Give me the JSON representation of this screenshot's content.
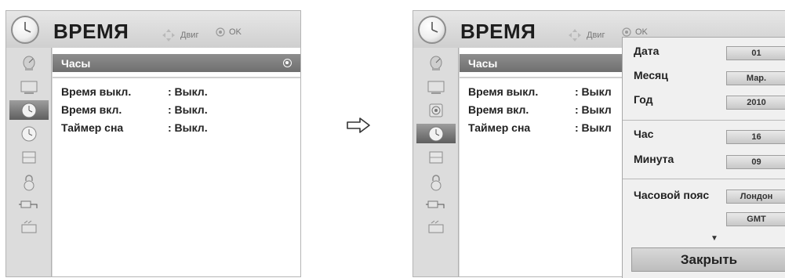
{
  "left_screen": {
    "title": "ВРЕМЯ",
    "hints": {
      "move": "Двиг",
      "ok": "OK"
    },
    "sidebar": [
      {
        "icon": "satellite-dish-icon"
      },
      {
        "icon": "monitor-icon"
      },
      {
        "icon": "clock-icon",
        "selected": true
      },
      {
        "icon": "clock-icon"
      },
      {
        "icon": "parental-lock-icon"
      },
      {
        "icon": "padlock-icon"
      },
      {
        "icon": "input-plug-icon"
      },
      {
        "icon": "keyboard-icon"
      }
    ],
    "menu": {
      "selected_item": "Часы",
      "items": [
        {
          "label": "Время выкл.",
          "value": ": Выкл."
        },
        {
          "label": "Время вкл.",
          "value": ": Выкл."
        },
        {
          "label": "Таймер сна",
          "value": ": Выкл."
        }
      ]
    }
  },
  "transition_arrow": "arrow-right-icon",
  "right_screen": {
    "title": "ВРЕМЯ",
    "hints": {
      "move": "Двиг",
      "ok": "OK"
    },
    "sidebar": [
      {
        "icon": "satellite-dish-icon"
      },
      {
        "icon": "monitor-icon"
      },
      {
        "icon": "speaker-icon"
      },
      {
        "icon": "clock-icon",
        "selected": true
      },
      {
        "icon": "parental-lock-icon"
      },
      {
        "icon": "padlock-icon"
      },
      {
        "icon": "input-plug-icon"
      },
      {
        "icon": "keyboard-icon"
      }
    ],
    "menu": {
      "selected_item": "Часы",
      "items": [
        {
          "label": "Время выкл.",
          "value": ": Выкл"
        },
        {
          "label": "Время вкл.",
          "value": ": Выкл"
        },
        {
          "label": "Таймер сна",
          "value": ": Выкл"
        }
      ]
    },
    "clock_popup": {
      "fields": [
        {
          "label": "Дата",
          "value": "01"
        },
        {
          "label": "Месяц",
          "value": "Мар."
        },
        {
          "label": "Год",
          "value": "2010"
        },
        {
          "label": "Час",
          "value": "16"
        },
        {
          "label": "Минута",
          "value": "09"
        },
        {
          "label": "Часовой пояс",
          "value": "Лондон"
        },
        {
          "label": "",
          "value": "GMT"
        }
      ],
      "more_indicator": "▼",
      "close_label": "Закрыть"
    }
  },
  "colors": {
    "selected_row": "#7d7d7d",
    "panel_bg": "#d9d9d9",
    "content_bg": "#ffffff",
    "popup_bg": "#f0f0f0"
  }
}
